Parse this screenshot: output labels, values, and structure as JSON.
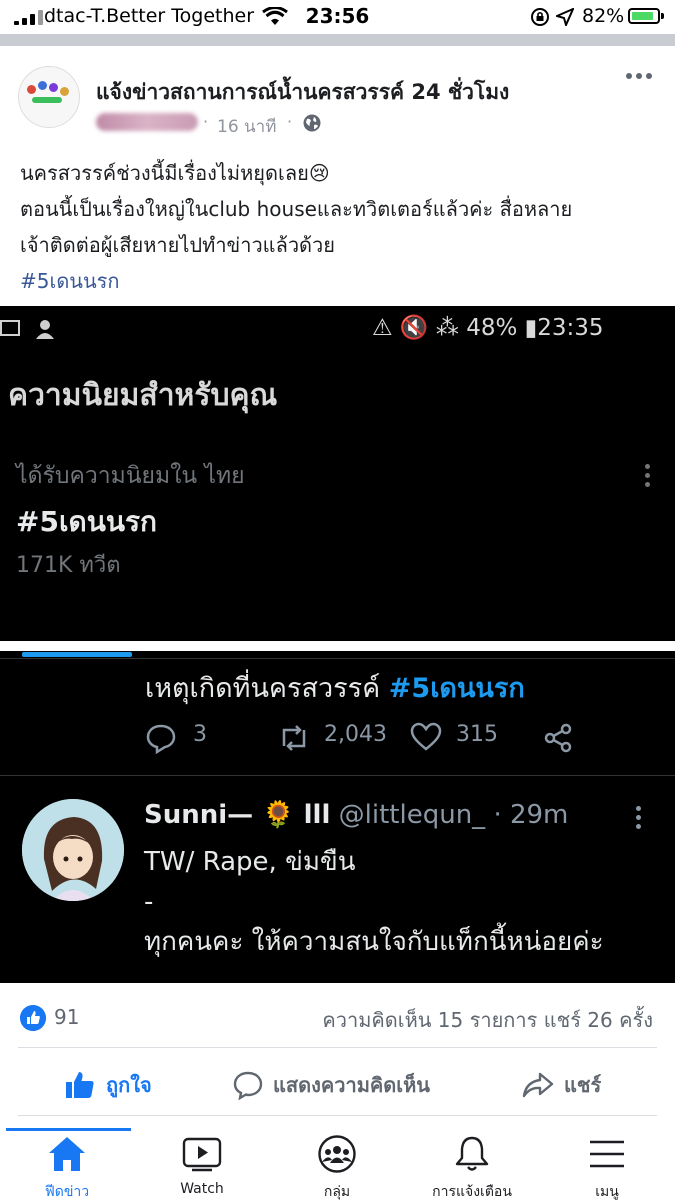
{
  "status_bar": {
    "carrier": "dtac-T.Better Together",
    "time": "23:56",
    "battery": "82%"
  },
  "post": {
    "page_name": "แจ้งข่าวสถานการณ์น้ำนครสวรรค์ 24 ชั่วโมง",
    "time_ago": "16 นาที",
    "lines": [
      "นครสวรรค์ช่วงนี้มีเรื่องไม่หยุดเลย😢",
      "ตอนนี้เป็นเรื่องใหญ่ในclub houseและทวิตเตอร์แล้วค่ะ สื่อหลาย",
      "เจ้าติดต่อผู้เสียหายไปทำข่าวแล้วด้วย"
    ],
    "hashtag": "#5เดนนรก"
  },
  "embed": {
    "status": "⚠ 🔇 ⁂ 48% ▮23:35",
    "heading": "ความนิยมสำหรับคุณ",
    "trend_label": "ได้รับความนิยมใน ไทย",
    "trend_name": "#5เดนนรก",
    "trend_count": "171K ทวีต",
    "tweet1_text": "เหตุเกิดที่นครสวรรค์ ",
    "tweet1_tag": "#5เดนนรก",
    "replies": "3",
    "retweets": "2,043",
    "likes": "315",
    "user_name": "Sunni— 🌻 lll",
    "user_handle": "@littlequn_ · 29m",
    "tweet2_lines": [
      "TW/ Rape, ข่มขืน",
      "-",
      "ทุกคนคะ ให้ความสนใจกับแท็กนี้หน่อยค่ะ"
    ]
  },
  "reactions": {
    "like_count": "91",
    "stats": "ความคิดเห็น 15 รายการ  แชร์ 26 ครั้ง"
  },
  "actions": {
    "like": "ถูกใจ",
    "comment": "แสดงความคิดเห็น",
    "share": "แชร์"
  },
  "nav": {
    "feed": "ฟีดข่าว",
    "watch": "Watch",
    "groups": "กลุ่ม",
    "notifications": "การแจ้งเตือน",
    "menu": "เมนู"
  },
  "colors": {
    "accent": "#1877f2",
    "twitter_blue": "#1d9bf0",
    "hashtag": "#385898"
  }
}
